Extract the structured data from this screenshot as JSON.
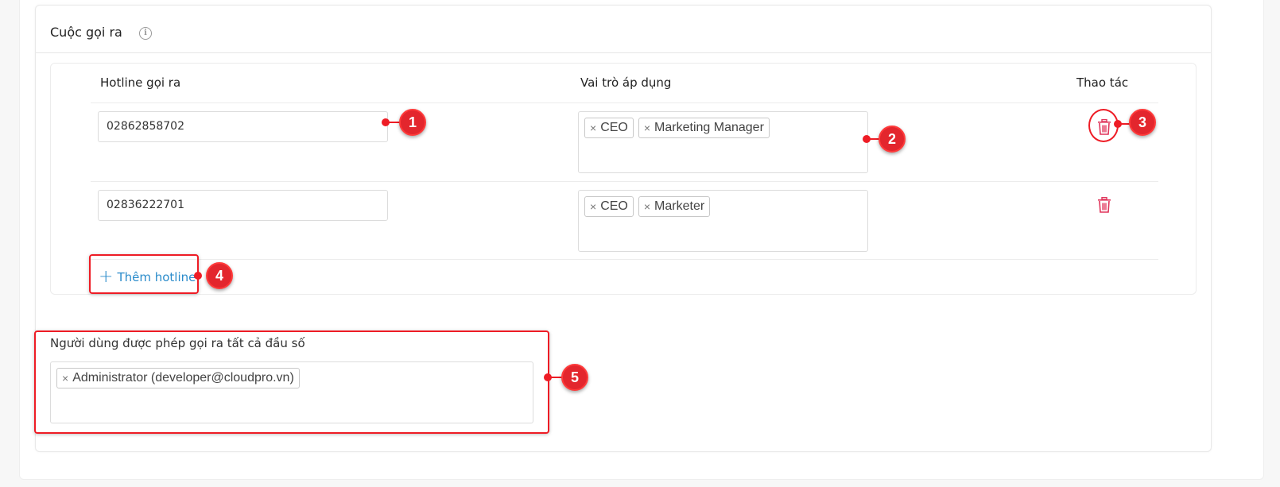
{
  "section": {
    "title": "Cuộc gọi ra",
    "info_icon": "info-icon"
  },
  "table": {
    "headers": {
      "hotline": "Hotline gọi ra",
      "roles": "Vai trò áp dụng",
      "actions": "Thao tác"
    },
    "rows": [
      {
        "hotline": "02862858702",
        "roles": [
          "CEO",
          "Marketing Manager"
        ],
        "action_icon": "trash-icon"
      },
      {
        "hotline": "02836222701",
        "roles": [
          "CEO",
          "Marketer"
        ],
        "action_icon": "trash-icon"
      }
    ],
    "add_button_label": "Thêm hotline",
    "add_button_icon": "plus-icon"
  },
  "all_numbers_users": {
    "label": "Người dùng được phép gọi ra tất cả đầu số",
    "users": [
      "Administrator (developer@cloudpro.vn)"
    ]
  },
  "tag_remove_glyph": "×",
  "annotations": [
    "1",
    "2",
    "3",
    "4",
    "5"
  ],
  "colors": {
    "accent_link": "#2b8ccb",
    "delete_icon": "#e0345a",
    "annotation": "#ee1c25"
  }
}
